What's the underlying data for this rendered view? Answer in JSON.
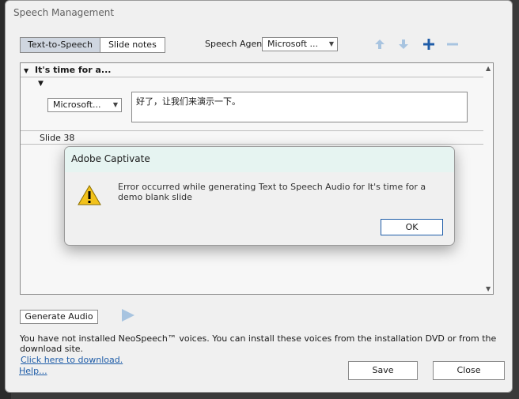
{
  "window": {
    "title": "Speech Management"
  },
  "tabs": [
    {
      "label": "Text-to-Speech",
      "active": true
    },
    {
      "label": "Slide notes",
      "active": false
    }
  ],
  "speech_agent": {
    "label": "Speech Agent",
    "value": "Microsoft ..."
  },
  "toolbar": {
    "up_icon": "arrow-up-icon",
    "down_icon": "arrow-down-icon",
    "add_icon": "plus-icon",
    "remove_icon": "minus-icon"
  },
  "panel": {
    "group_title": "It's time for a...",
    "voice_value": "Microsoft...",
    "speech_text": "好了，让我们来演示一下。",
    "slide_label": "Slide 38"
  },
  "generate_audio_label": "Generate Audio",
  "info_text": "You have not installed NeoSpeech™ voices. You can install these voices from the installation DVD or from the download site.",
  "download_link": "Click here to download.",
  "help_link": "Help...",
  "save_label": "Save",
  "close_label": "Close",
  "modal": {
    "title": "Adobe Captivate",
    "message": "Error occurred while generating Text to Speech Audio for It's time for a demo blank slide",
    "ok_label": "OK",
    "icon": "warning-icon"
  },
  "colors": {
    "accent": "#1f5da8",
    "modal_header": "#e6f4f1",
    "warning": "#f2c21b"
  }
}
